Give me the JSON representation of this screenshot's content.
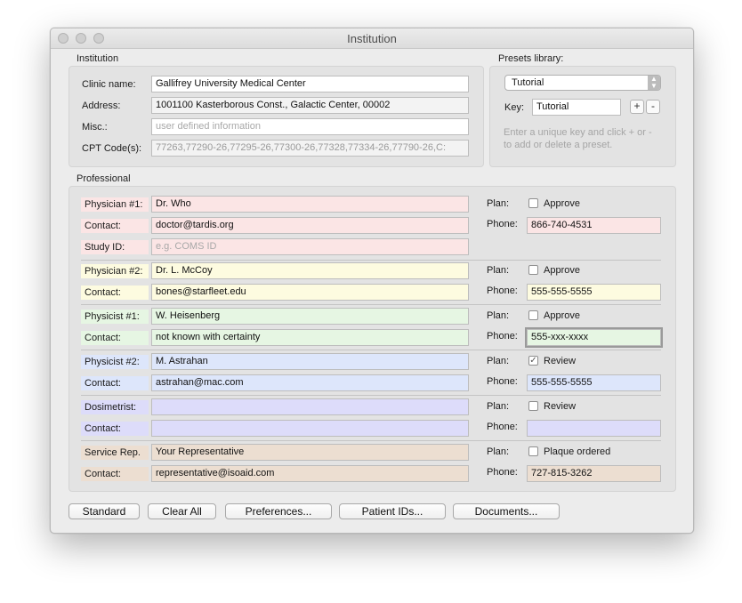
{
  "window": {
    "title": "Institution"
  },
  "institution": {
    "section_title": "Institution",
    "clinic_name_label": "Clinic name:",
    "clinic_name_value": "Gallifrey University Medical Center",
    "address_label": "Address:",
    "address_value": "1001100 Kasterborous Const., Galactic Center, 00002",
    "misc_label": "Misc.:",
    "misc_placeholder": "user defined information",
    "cpt_label": "CPT Code(s):",
    "cpt_value": "77263,77290-26,77295-26,77300-26,77328,77334-26,77790-26,C:"
  },
  "presets": {
    "section_title": "Presets library:",
    "selected": "Tutorial",
    "key_label": "Key:",
    "key_value": "Tutorial",
    "add_label": "+",
    "delete_label": "-",
    "hint": "Enter a unique key and click + or - to add or delete a preset."
  },
  "professional": {
    "section_title": "Professional",
    "plan_label": "Plan:",
    "phone_label": "Phone:",
    "physician1": {
      "role_label": "Physician #1:",
      "name": "Dr. Who",
      "contact_label": "Contact:",
      "contact": "doctor@tardis.org",
      "plan_option": "Approve",
      "plan_checked": false,
      "phone": "866-740-4531",
      "study_label": "Study ID:",
      "study_placeholder": "e.g. COMS ID"
    },
    "physician2": {
      "role_label": "Physician #2:",
      "name": "Dr. L. McCoy",
      "contact_label": "Contact:",
      "contact": "bones@starfleet.edu",
      "plan_option": "Approve",
      "plan_checked": false,
      "phone": "555-555-5555"
    },
    "physicist1": {
      "role_label": "Physicist #1:",
      "name": "W. Heisenberg",
      "contact_label": "Contact:",
      "contact": "not known with certainty",
      "plan_option": "Approve",
      "plan_checked": false,
      "phone": "555-xxx-xxxx"
    },
    "physicist2": {
      "role_label": "Physicist #2:",
      "name": "M. Astrahan",
      "contact_label": "Contact:",
      "contact": "astrahan@mac.com",
      "plan_option": "Review",
      "plan_checked": true,
      "phone": "555-555-5555"
    },
    "dosimetrist": {
      "role_label": "Dosimetrist:",
      "name": "",
      "contact_label": "Contact:",
      "contact": "",
      "plan_option": "Review",
      "plan_checked": false,
      "phone": ""
    },
    "service": {
      "role_label": "Service Rep.",
      "name": "Your Representative",
      "contact_label": "Contact:",
      "contact": "representative@isoaid.com",
      "plan_option": "Plaque ordered",
      "plan_checked": false,
      "phone": "727-815-3262"
    }
  },
  "buttons": {
    "standard": "Standard",
    "clear_all": "Clear All",
    "preferences": "Preferences...",
    "patient_ids": "Patient IDs...",
    "documents": "Documents..."
  },
  "colors": {
    "physician1": "#fbe5e5",
    "physician2": "#fdfbe0",
    "physicist1": "#e6f6e3",
    "physicist2": "#dde6fb",
    "dosimetrist": "#dddcfa",
    "service": "#ecded1"
  }
}
